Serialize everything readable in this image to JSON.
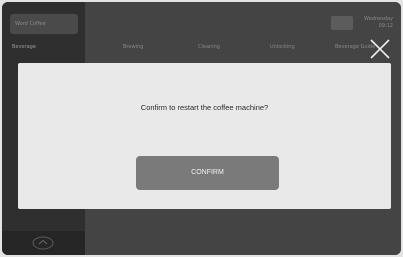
{
  "sidebar": {
    "header_label": "Word Coffee",
    "item_label": "Beverage"
  },
  "tabs": [
    {
      "label": "Brewing"
    },
    {
      "label": "Cleaning"
    },
    {
      "label": "Unlocking"
    },
    {
      "label": "Beverage Guide"
    }
  ],
  "status": {
    "line1": "Wednesday",
    "line2": "09:12"
  },
  "icons": {
    "close": "close-icon",
    "home": "home-icon",
    "status": "status-icon"
  },
  "dialog": {
    "message": "Confirm to restart the coffee machine?",
    "confirm_label": "CONFIRM"
  }
}
